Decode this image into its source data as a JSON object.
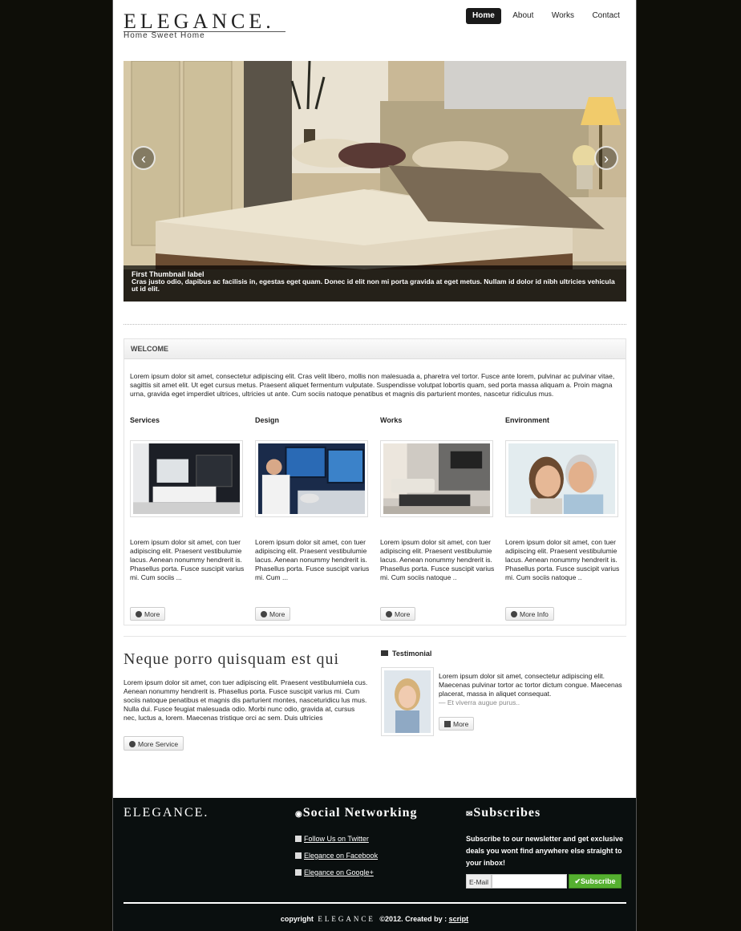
{
  "header": {
    "logo": "ELEGANCE.",
    "tagline": "Home Sweet Home",
    "nav": [
      {
        "label": "Home",
        "active": true
      },
      {
        "label": "About",
        "active": false
      },
      {
        "label": "Works",
        "active": false
      },
      {
        "label": "Contact",
        "active": false
      }
    ]
  },
  "carousel": {
    "caption_title": "First Thumbnail label",
    "caption_text": "Cras justo odio, dapibus ac facilisis in, egestas eget quam. Donec id elit non mi porta gravida at eget metus. Nullam id dolor id nibh ultricies vehicula ut id elit.",
    "prev_icon": "chevron-left-icon",
    "next_icon": "chevron-right-icon"
  },
  "welcome": {
    "heading": "WELCOME",
    "text": "Lorem ipsum dolor sit amet, consectetur adipiscing elit. Cras velit libero, mollis non malesuada a, pharetra vel tortor. Fusce ante lorem, pulvinar ac pulvinar vitae, sagittis sit amet elit. Ut eget cursus metus. Praesent aliquet fermentum vulputate. Suspendisse volutpat lobortis quam, sed porta massa aliquam a. Proin magna urna, gravida eget imperdiet ultrices, ultricies ut ante. Cum sociis natoque penatibus et magnis dis parturient montes, nascetur ridiculus mus.",
    "columns": [
      {
        "title": "Services",
        "text": "Lorem ipsum dolor sit amet, con tuer adipiscing elit. Praesent vestibulumie lacus. Aenean nonummy hendrerit is. Phasellus porta. Fusce suscipit varius mi. Cum sociis ...",
        "button": "More"
      },
      {
        "title": "Design",
        "text": "Lorem ipsum dolor sit amet, con tuer adipiscing elit. Praesent vestibulumie lacus. Aenean nonummy hendrerit is. Phasellus porta. Fusce suscipit varius mi. Cum ...",
        "button": "More"
      },
      {
        "title": "Works",
        "text": "Lorem ipsum dolor sit amet, con tuer adipiscing elit. Praesent vestibulumie lacus. Aenean nonummy hendrerit is. Phasellus porta. Fusce suscipit varius mi. Cum sociis natoque ..",
        "button": "More"
      },
      {
        "title": "Environment",
        "text": "Lorem ipsum dolor sit amet, con tuer adipiscing elit. Praesent vestibulumie lacus. Aenean nonummy hendrerit is. Phasellus porta. Fusce suscipit varius mi. Cum sociis natoque ..",
        "button": "More Info"
      }
    ]
  },
  "services": {
    "title": "Neque porro quisquam est qui",
    "text": "Lorem ipsum dolor sit amet, con tuer adipiscing elit. Praesent vestibulumiela cus. Aenean nonummy hendrerit is. Phasellus porta. Fusce suscipit varius mi. Cum sociis natoque penatibus et magnis dis parturient montes, nasceturidicu lus mus. Nulla dui. Fusce feugiat malesuada odio. Morbi nunc odio, gravida at, cursus nec, luctus a, lorem. Maecenas tristique orci ac sem. Duis ultricies",
    "button": "More Service"
  },
  "testimonial": {
    "title": "Testimonial",
    "text": "Lorem ipsum dolor sit amet, consectetur adipiscing elit. Maecenas pulvinar tortor ac tortor dictum congue. Maecenas placerat, massa in aliquet consequat.",
    "author": "— Et viverra augue purus..",
    "button": "More"
  },
  "footer": {
    "logo": "ELEGANCE.",
    "social_heading": "Social Networking",
    "social_links": [
      {
        "label": "Follow Us on Twitter",
        "icon": "twitter-icon"
      },
      {
        "label": "Elegance on Facebook",
        "icon": "facebook-icon"
      },
      {
        "label": "Elegance on Google+",
        "icon": "google-plus-icon"
      }
    ],
    "subscribe_heading": "Subscribes",
    "subscribe_text": "Subscribe to our newsletter and get exclusive deals you wont find anywhere else straight to your inbox!",
    "email_label": "E-Mail",
    "email_value": "",
    "subscribe_button": "Subscribe",
    "copyright_prefix": "copyright",
    "copyright_brand": "ELEGANCE",
    "copyright_year": "©2012. Created by :",
    "copyright_author": "script"
  },
  "colors": {
    "background": "#0e0e08",
    "footer_bg": "#0a0f0f",
    "subscribe_green": "#55b030",
    "nav_active": "#1a1a1a"
  }
}
